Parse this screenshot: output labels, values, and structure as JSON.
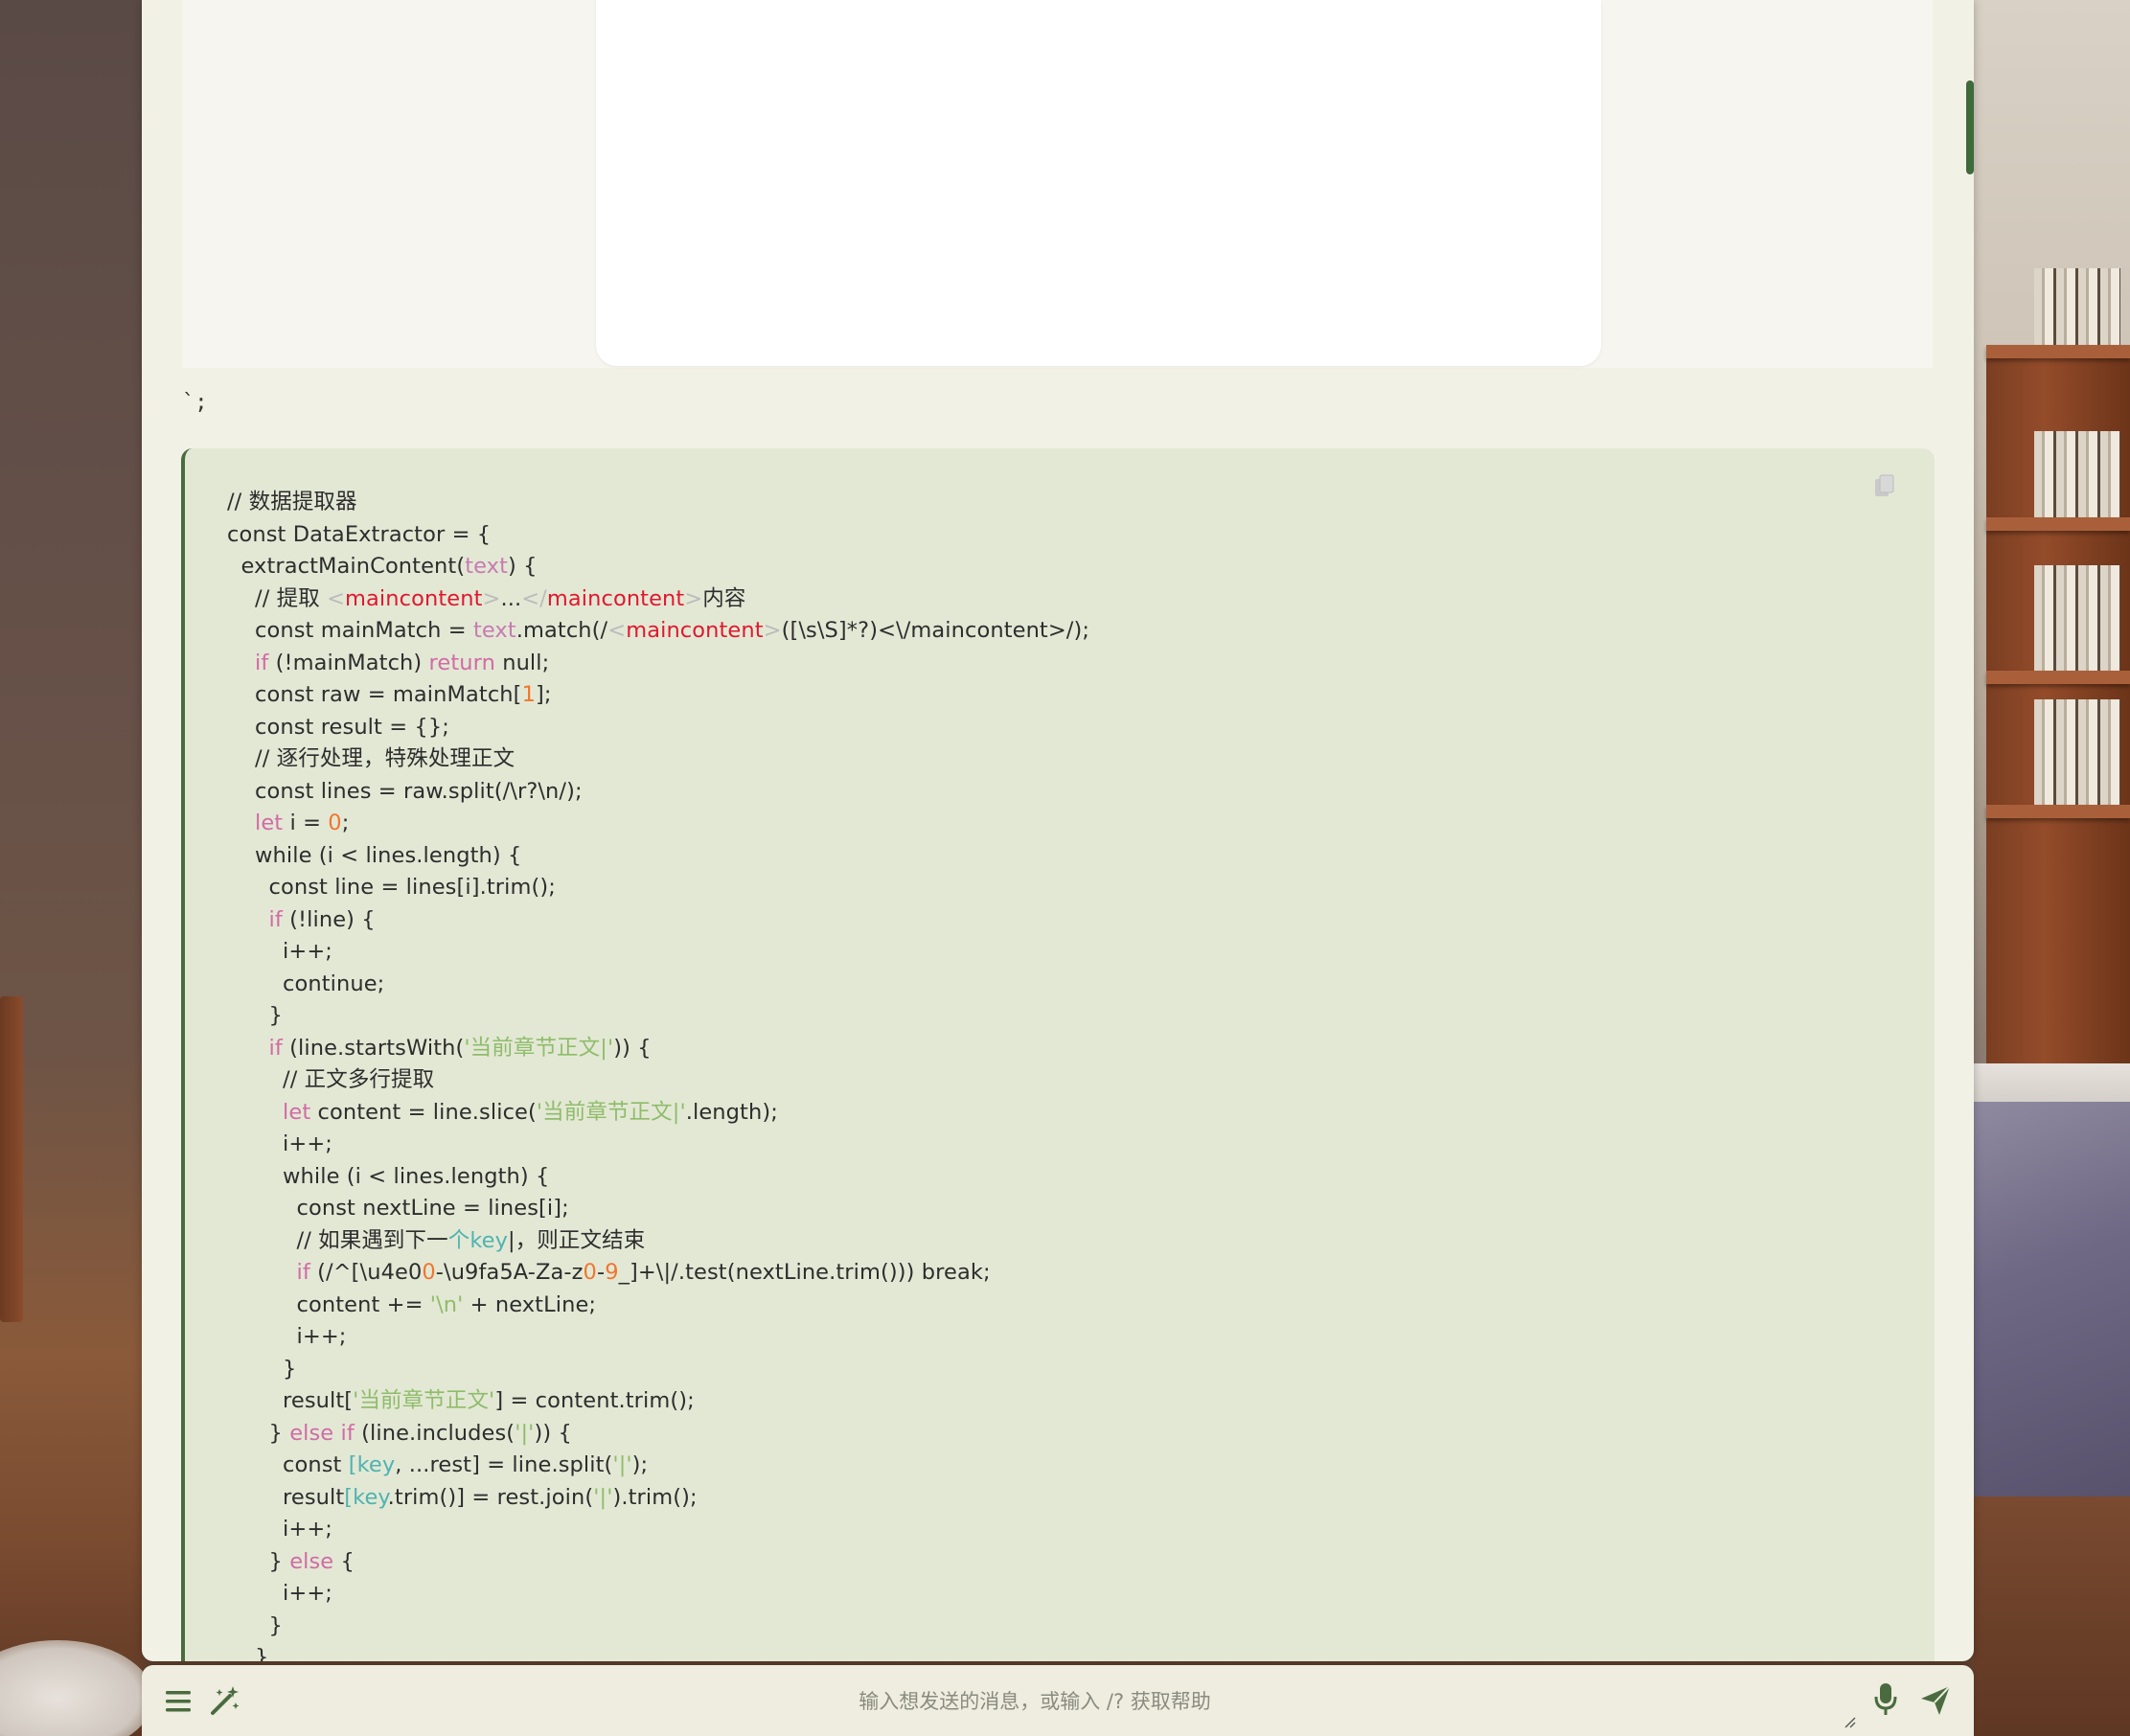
{
  "colors": {
    "panel_bg": "#f2f1e6",
    "code_bg": "#e3e8d5",
    "code_border": "#4a6b3f",
    "accent_green": "#4a6b3f",
    "keyword": "#d16ba5",
    "string": "#8fbc6a",
    "number": "#f0762e",
    "tag": "#e0182e"
  },
  "chat": {
    "stray_text": "`;",
    "code_block": {
      "copy_icon": "copy-icon",
      "lines": [
        [
          {
            "t": "// 数据提取器"
          }
        ],
        [
          {
            "t": "const DataExtractor = {"
          }
        ],
        [
          {
            "t": "  extractMainContent("
          },
          {
            "t": "text",
            "c": "param"
          },
          {
            "t": ") {"
          }
        ],
        [
          {
            "t": "    // 提取 "
          },
          {
            "t": "<",
            "c": "ang"
          },
          {
            "t": "maincontent",
            "c": "tag"
          },
          {
            "t": ">",
            "c": "ang"
          },
          {
            "t": "...",
            "c": ""
          },
          {
            "t": "</",
            "c": "ang"
          },
          {
            "t": "maincontent",
            "c": "tag"
          },
          {
            "t": ">",
            "c": "ang"
          },
          {
            "t": "内容"
          }
        ],
        [
          {
            "t": "    const mainMatch = "
          },
          {
            "t": "text",
            "c": "param"
          },
          {
            "t": ".match(/"
          },
          {
            "t": "<",
            "c": "ang"
          },
          {
            "t": "maincontent",
            "c": "tag"
          },
          {
            "t": ">",
            "c": "ang"
          },
          {
            "t": "([\\s\\S]*?)<\\/maincontent>/);"
          }
        ],
        [
          {
            "t": "    "
          },
          {
            "t": "if",
            "c": "kw"
          },
          {
            "t": " (!mainMatch) "
          },
          {
            "t": "return",
            "c": "kw"
          },
          {
            "t": " null;"
          }
        ],
        [
          {
            "t": "    const raw = mainMatch["
          },
          {
            "t": "1",
            "c": "num"
          },
          {
            "t": "];"
          }
        ],
        [
          {
            "t": "    const result = {};"
          }
        ],
        [
          {
            "t": "    // 逐行处理，特殊处理正文"
          }
        ],
        [
          {
            "t": "    const lines = raw.split(/\\r?\\n/);"
          }
        ],
        [
          {
            "t": "    "
          },
          {
            "t": "let",
            "c": "kw"
          },
          {
            "t": " i = "
          },
          {
            "t": "0",
            "c": "num"
          },
          {
            "t": ";"
          }
        ],
        [
          {
            "t": "    while (i < lines.length) {"
          }
        ],
        [
          {
            "t": "      const line = lines[i].trim();"
          }
        ],
        [
          {
            "t": "      "
          },
          {
            "t": "if",
            "c": "kw"
          },
          {
            "t": " (!line) {"
          }
        ],
        [
          {
            "t": "        i++;"
          }
        ],
        [
          {
            "t": "        continue;"
          }
        ],
        [
          {
            "t": "      }"
          }
        ],
        [
          {
            "t": "      "
          },
          {
            "t": "if",
            "c": "kw"
          },
          {
            "t": " (line.startsWith("
          },
          {
            "t": "'当前章节正文|'",
            "c": "str"
          },
          {
            "t": ")) {"
          }
        ],
        [
          {
            "t": "        // 正文多行提取"
          }
        ],
        [
          {
            "t": "        "
          },
          {
            "t": "let",
            "c": "kw"
          },
          {
            "t": " content = line.slice("
          },
          {
            "t": "'当前章节正文|'",
            "c": "str"
          },
          {
            "t": ".length);"
          }
        ],
        [
          {
            "t": "        i++;"
          }
        ],
        [
          {
            "t": "        while (i < lines.length) {"
          }
        ],
        [
          {
            "t": "          const nextLine = lines[i];"
          }
        ],
        [
          {
            "t": "          // 如果遇到下一"
          },
          {
            "t": "个key",
            "c": "teal"
          },
          {
            "t": "|，则正文结束"
          }
        ],
        [
          {
            "t": "          "
          },
          {
            "t": "if",
            "c": "kw"
          },
          {
            "t": " (/^[\\u4e0"
          },
          {
            "t": "0",
            "c": "num"
          },
          {
            "t": "-\\u9fa5A-Za-z"
          },
          {
            "t": "0",
            "c": "num"
          },
          {
            "t": "-"
          },
          {
            "t": "9",
            "c": "num"
          },
          {
            "t": "_]+\\|/.test(nextLine.trim())) break;"
          }
        ],
        [
          {
            "t": "          content += "
          },
          {
            "t": "'\\n'",
            "c": "str"
          },
          {
            "t": " + nextLine;"
          }
        ],
        [
          {
            "t": "          i++;"
          }
        ],
        [
          {
            "t": "        }"
          }
        ],
        [
          {
            "t": "        result["
          },
          {
            "t": "'当前章节正文'",
            "c": "str"
          },
          {
            "t": "] = content.trim();"
          }
        ],
        [
          {
            "t": "      } "
          },
          {
            "t": "else if",
            "c": "kw"
          },
          {
            "t": " (line.includes("
          },
          {
            "t": "'|'",
            "c": "str"
          },
          {
            "t": ")) {"
          }
        ],
        [
          {
            "t": "        const "
          },
          {
            "t": "[key",
            "c": "teal"
          },
          {
            "t": ", ...rest] = line.split("
          },
          {
            "t": "'|'",
            "c": "str"
          },
          {
            "t": ");"
          }
        ],
        [
          {
            "t": "        result"
          },
          {
            "t": "[key",
            "c": "teal"
          },
          {
            "t": ".trim()] = rest.join("
          },
          {
            "t": "'|'",
            "c": "str"
          },
          {
            "t": ").trim();"
          }
        ],
        [
          {
            "t": "        i++;"
          }
        ],
        [
          {
            "t": "      } "
          },
          {
            "t": "else",
            "c": "kw"
          },
          {
            "t": " {"
          }
        ],
        [
          {
            "t": "        i++;"
          }
        ],
        [
          {
            "t": "      }"
          }
        ],
        [
          {
            "t": "    }"
          }
        ]
      ]
    }
  },
  "input_bar": {
    "menu_icon": "hamburger-menu-icon",
    "magic_icon": "magic-wand-icon",
    "placeholder": "输入想发送的消息，或输入 /? 获取帮助",
    "value": "",
    "mic_icon": "microphone-icon",
    "send_icon": "send-icon"
  }
}
